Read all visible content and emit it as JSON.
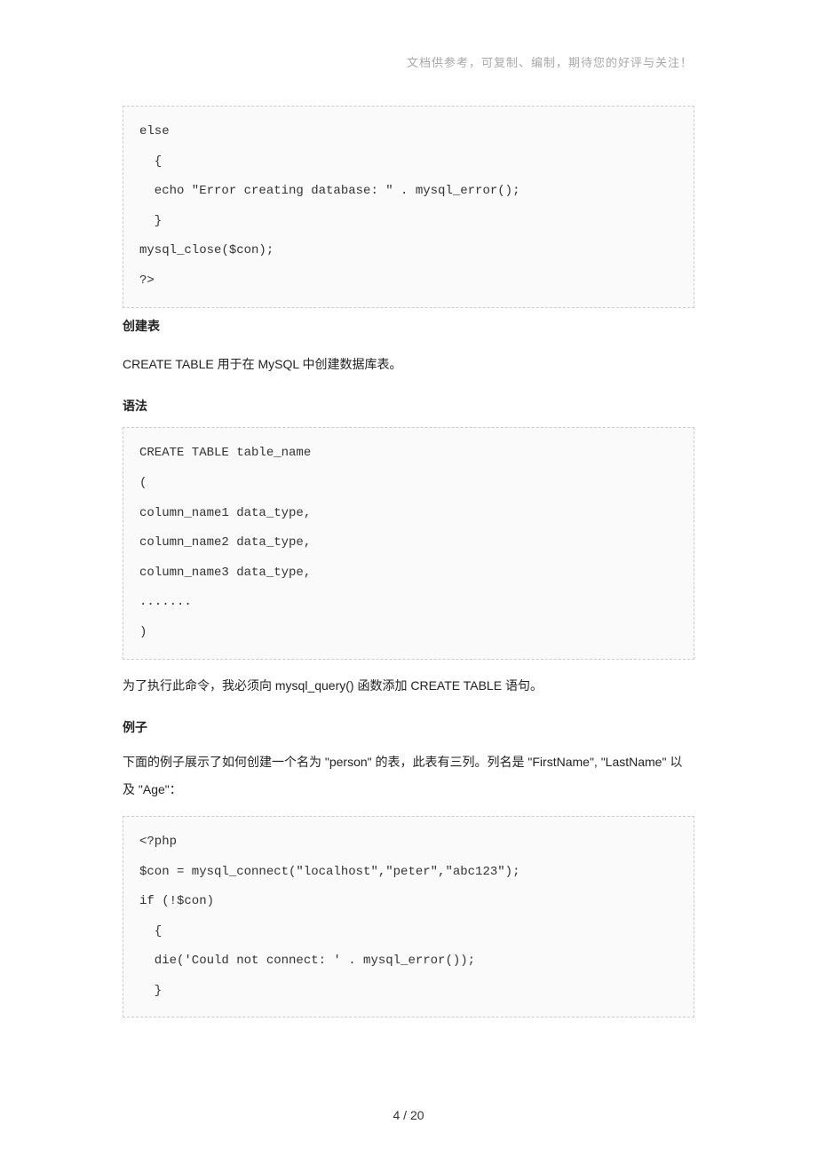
{
  "header_note": "文档供参考，可复制、编制，期待您的好评与关注！",
  "code1": "else\n  {\n  echo \"Error creating database: \" . mysql_error();\n  }\nmysql_close($con);\n?>",
  "heading1": "创建表",
  "para1": "CREATE TABLE 用于在 MySQL 中创建数据库表。",
  "subheading_syntax": "语法",
  "code2": "CREATE TABLE table_name\n(\ncolumn_name1 data_type,\ncolumn_name2 data_type,\ncolumn_name3 data_type,\n.......\n)",
  "para2": "为了执行此命令，我必须向 mysql_query() 函数添加 CREATE TABLE 语句。",
  "subheading_example": "例子",
  "para3": "下面的例子展示了如何创建一个名为 \"person\" 的表，此表有三列。列名是 \"FirstName\", \"LastName\" 以及 \"Age\"：",
  "code3": "<?php\n$con = mysql_connect(\"localhost\",\"peter\",\"abc123\");\nif (!$con)\n  {\n  die('Could not connect: ' . mysql_error());\n  }",
  "page_number": "4 / 20"
}
